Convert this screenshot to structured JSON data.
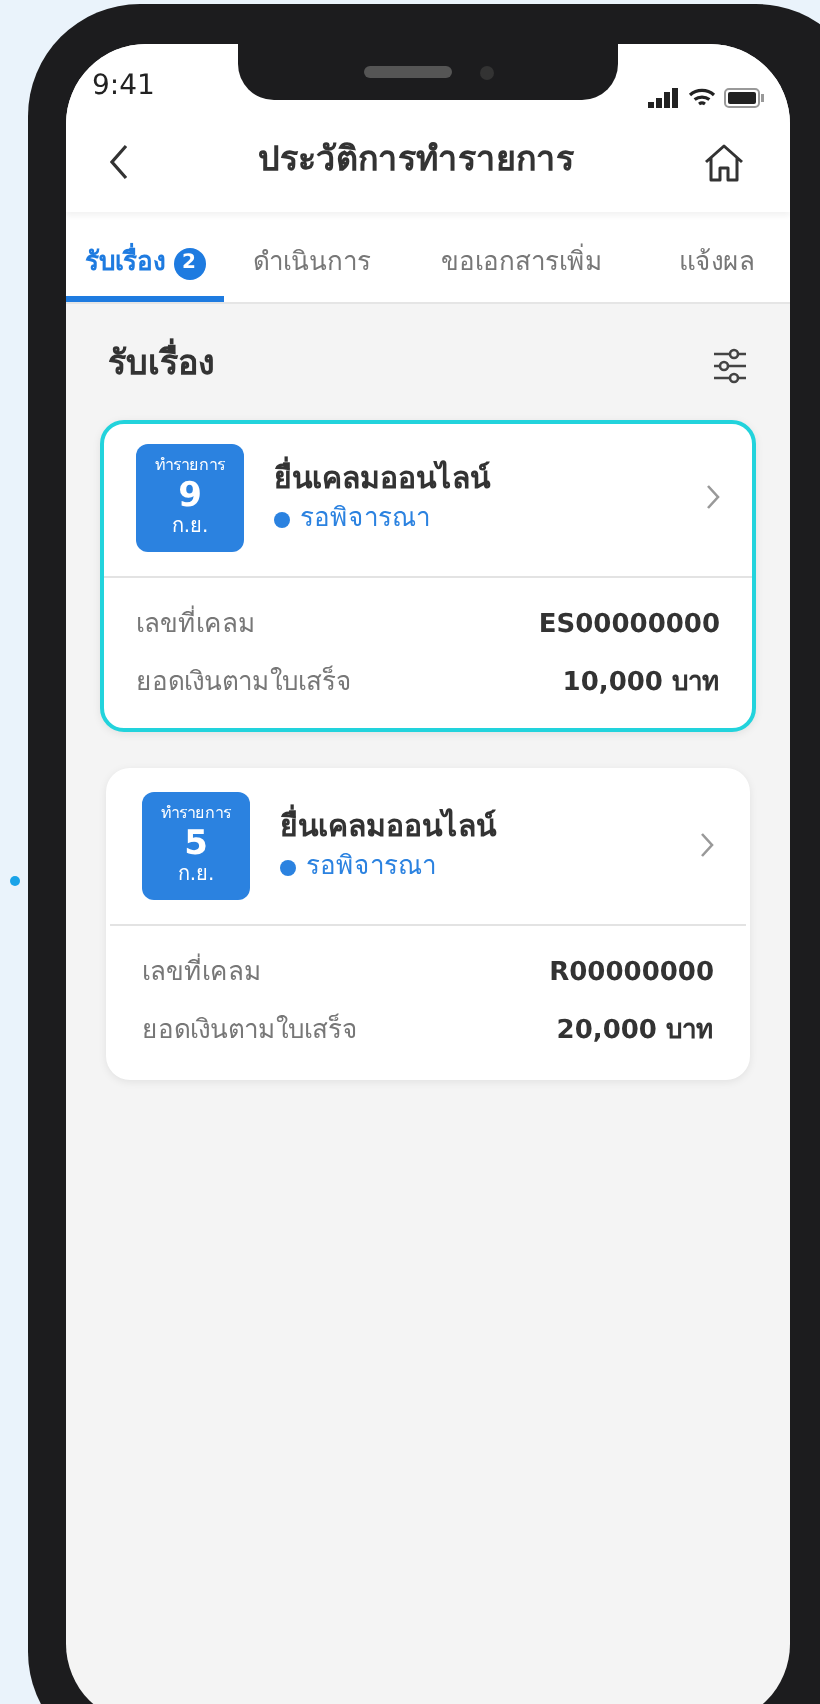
{
  "status_bar": {
    "time": "9:41"
  },
  "header": {
    "title": "ประวัติการทำรายการ"
  },
  "tabs": [
    {
      "label": "รับเรื่อง",
      "badge": "2",
      "selected": true
    },
    {
      "label": "ดำเนินการ",
      "selected": false
    },
    {
      "label": "ขอเอกสารเพิ่ม",
      "selected": false
    },
    {
      "label": "แจ้งผล",
      "selected": false
    }
  ],
  "section": {
    "title": "รับเรื่อง"
  },
  "cards": [
    {
      "selected": true,
      "date_caption": "ทำรายการ",
      "day": "9",
      "month": "ก.ย.",
      "title": "ยื่นเคลมออนไลน์",
      "status": "รอพิจารณา",
      "rows": [
        {
          "label": "เลขที่เคลม",
          "value": "ES00000000"
        },
        {
          "label": "ยอดเงินตามใบเสร็จ",
          "value": "10,000 บาท"
        }
      ]
    },
    {
      "selected": false,
      "date_caption": "ทำรายการ",
      "day": "5",
      "month": "ก.ย.",
      "title": "ยื่นเคลมออนไลน์",
      "status": "รอพิจารณา",
      "rows": [
        {
          "label": "เลขที่เคลม",
          "value": "R00000000"
        },
        {
          "label": "ยอดเงินตามใบเสร็จ",
          "value": "20,000 บาท"
        }
      ]
    }
  ]
}
